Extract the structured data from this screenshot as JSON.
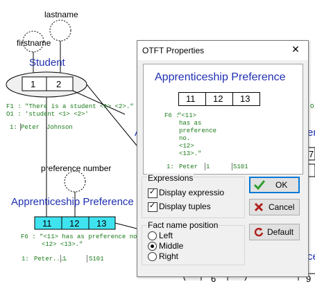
{
  "diagram": {
    "lastname_label": "lastname",
    "firstname_label": "firstname",
    "student_title": "Student",
    "student_roles": [
      "1",
      "2"
    ],
    "student_f1": "F1 : \"There is a student <1> <2>.\"",
    "student_o1": "O1 : 'student <1> <2>'",
    "student_row_num": "1:",
    "student_row_first": "Peter",
    "student_row_last": "Johnson",
    "preference_label": "preference number",
    "appr_title": "Apprenticeship Preference",
    "appr_roles": [
      "11",
      "12",
      "13"
    ],
    "appr_f6": "F6 : \"<11> has as preference no.",
    "appr_f6_line2": "<12> <13>.\"",
    "appr_row_num": "1:",
    "appr_row_a": "Peter....",
    "appr_row_b": "1",
    "appr_row_c": "S101",
    "right_fragments": {
      "o": "O",
      "ent": "ent",
      "num7": "7",
      "ces": "ces",
      "num9": "9",
      "num6": "6",
      "a_frag": "A"
    }
  },
  "dialog": {
    "title": "OTFT Properties",
    "close": "✕",
    "preview": {
      "title": "Apprenticeship Preference",
      "roles": [
        "11",
        "12",
        "13"
      ],
      "f6_label": "F6 :",
      "f6_lines": [
        "\"<11>",
        "has as",
        "preference",
        "no.",
        "<12>",
        "<13>.\""
      ],
      "row_num": "1:",
      "row_a": "Peter",
      "row_b": "1",
      "row_c": "S101"
    },
    "expressions": {
      "legend": "Expressions",
      "display_expressions": "Display expressio",
      "display_tuples": "Display tuples"
    },
    "fact_position": {
      "legend": "Fact name position",
      "options": [
        "Left",
        "Middle",
        "Right"
      ],
      "selected": "Middle"
    },
    "buttons": {
      "ok": "OK",
      "cancel": "Cancel",
      "default": "Default"
    }
  },
  "colors": {
    "accent_blue": "#1f2fb0",
    "cyan_role": "#3fe3f0",
    "green_text": "#1a7a1a",
    "ok_green": "#2e9e2e",
    "cancel_red": "#b0201e"
  }
}
